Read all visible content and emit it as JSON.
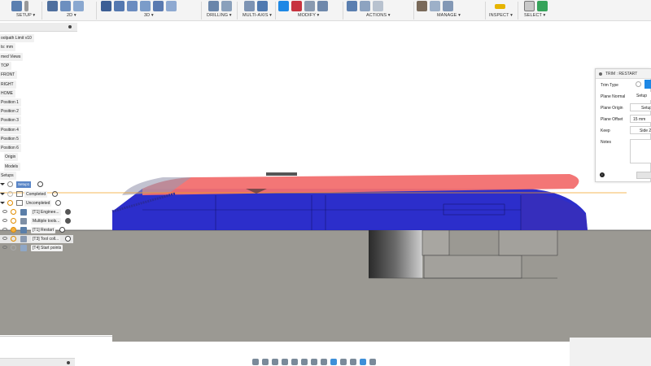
{
  "colors": {
    "toolbar_bg": "#f4f4f4",
    "stock_gray": "#9b9993",
    "part_blue": "#1f22c8",
    "trim_red": "#f26f6f",
    "selection_accent": "#1e88e5",
    "orange_line": "#f0a020"
  },
  "toolbar": {
    "groups": [
      {
        "label": "SETUP ▾",
        "icons": [
          "setup-icon",
          "setup-sheet-icon"
        ]
      },
      {
        "label": "2D ▾",
        "icons": [
          "2d-adaptive-icon",
          "2d-pocket-icon",
          "2d-contour-icon"
        ]
      },
      {
        "label": "3D ▾",
        "icons": [
          "3d-adaptive-icon",
          "3d-pocket-icon",
          "3d-steep-icon",
          "3d-scallop-icon",
          "3d-contour-icon",
          "3d-radial-icon"
        ]
      },
      {
        "label": "DRILLING ▾",
        "icons": [
          "drill-icon",
          "bore-icon"
        ]
      },
      {
        "label": "MULTI-AXIS ▾",
        "icons": [
          "swarf-icon",
          "multiaxis-icon"
        ]
      },
      {
        "label": "MODIFY ▾",
        "icons": [
          "trim-icon",
          "delete-toolpath-icon",
          "move-icon",
          "shift-icon"
        ]
      },
      {
        "label": "ACTIONS ▾",
        "icons": [
          "simulate-icon",
          "post-process-icon",
          "setup-sheet-icon"
        ]
      },
      {
        "label": "MANAGE ▾",
        "icons": [
          "tool-library-icon",
          "template-icon",
          "post-library-icon"
        ]
      },
      {
        "label": "INSPECT ▾",
        "icons": [
          "measure-icon"
        ]
      },
      {
        "label": "SELECT ▾",
        "icons": [
          "select-box-icon",
          "select-filter-icon"
        ]
      }
    ]
  },
  "browser": {
    "items": [
      "oolpath Limit v10",
      "ts: mm",
      "med Views",
      "TOP",
      "FRONT",
      "RIGHT",
      "HOME",
      "Position 1",
      "Position 2",
      "Position 3",
      "Position 4",
      "Position 5",
      "Position 6",
      "Origin",
      "Models",
      "Setups"
    ],
    "setup_label": "Setup1",
    "groups": [
      "Completed",
      "Uncompleted"
    ],
    "operations": [
      "[T1] Enginee...",
      "Multiple tools...",
      "[T1] Restart",
      "[T3] Tool coll...",
      "[T4] Start points"
    ]
  },
  "dialog": {
    "title": "TRIM : RESTART",
    "fields": [
      {
        "label": "Trim Type",
        "value": ""
      },
      {
        "label": "Plane Normal",
        "value": "Setup"
      },
      {
        "label": "Plane Origin",
        "value": "Setup"
      },
      {
        "label": "Plane Offset",
        "value": "15 mm"
      },
      {
        "label": "Keep",
        "value": "Side 2"
      },
      {
        "label": "Notes",
        "value": ""
      }
    ],
    "info_icon": "i"
  },
  "navbar": {
    "icons": [
      "orbit-icon",
      "pan-icon",
      "look-at-icon",
      "zoom-icon",
      "fit-icon",
      "display-mode-icon",
      "grid-icon",
      "viewports-icon",
      "section-icon",
      "env-icon",
      "effects-icon",
      "select-icon",
      "camera-icon"
    ]
  }
}
